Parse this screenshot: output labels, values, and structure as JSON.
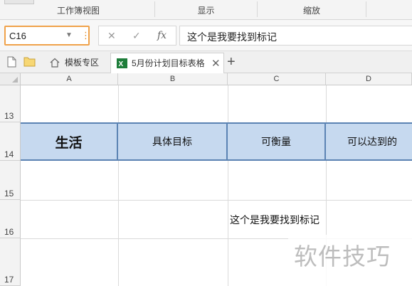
{
  "ribbon": {
    "groups": [
      "工作簿视图",
      "显示",
      "缩放"
    ]
  },
  "formula_bar": {
    "name_box": "C16",
    "cancel_symbol": "✕",
    "confirm_symbol": "✓",
    "fx_symbol": "fx",
    "content": "这个是我要找到标记"
  },
  "tabs": {
    "template_tab": "模板专区",
    "file_tab": "5月份计划目标表格",
    "add_symbol": "+"
  },
  "sheet": {
    "columns": [
      "A",
      "B",
      "C",
      "D"
    ],
    "rows": [
      "13",
      "14",
      "15",
      "16",
      "17"
    ],
    "row14": {
      "A": "生活",
      "B": "具体目标",
      "C": "可衡量",
      "D": "可以达到的"
    },
    "row16": {
      "C": "这个是我要找到标记"
    },
    "header_fill": "#c6d9ef",
    "header_border": "#5b83b3"
  },
  "watermark": "软件技巧"
}
